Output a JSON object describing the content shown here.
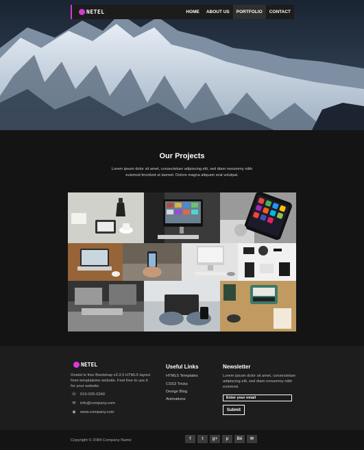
{
  "nav": {
    "brand": "NETEL",
    "links": [
      "HOME",
      "ABOUT US",
      "PORTFOLIO",
      "CONTACT"
    ],
    "active": "PORTFOLIO",
    "accent_color": "#d63ad6"
  },
  "hero": {
    "image": "snowy-mountain-range"
  },
  "projects": {
    "title": "Our Projects",
    "description": "Lorem ipsum dolor sit amet, consectetuer adipiscing elit, sed diam nonummy nibh euismod tincidunt ut laoreet. Dolore magna aliquam erat volutpat.",
    "tiles": [
      "desk-coffee-tablet",
      "imac-desk",
      "smartphone-apps",
      "laptop-wooden-desk",
      "hand-phone",
      "imac-workspace",
      "stationery-top-view",
      "office-monochrome",
      "hands-laptop",
      "typewriter-desk"
    ]
  },
  "footer": {
    "brand": "NETEL",
    "about": "Onetel is free Bootstrap v3.3.5 HTML5 layout from templatemo website. Feel free to use it for your website.",
    "phone": "010-020-0340",
    "email": "info@company.com",
    "website": "www.company.com",
    "useful_links_title": "Useful Links",
    "useful_links": [
      "HTML5 Templates",
      "CSS3 Tricks",
      "Design Blog",
      "Animations"
    ],
    "newsletter_title": "Newsletter",
    "newsletter_text": "Lorem ipsum dolor sit amet, consectetuer adipiscing elit, sed diam nonummy nibh euismod.",
    "email_placeholder": "Enter your email",
    "submit": "Submit"
  },
  "bottom": {
    "copyright": "Copyright © 2084 Company Name",
    "socials": [
      "f",
      "t",
      "g+",
      "p",
      "Bē",
      "✉"
    ],
    "social_icons": [
      "facebook-icon",
      "twitter-icon",
      "google-plus-icon",
      "pinterest-icon",
      "behance-icon",
      "mail-icon"
    ]
  }
}
